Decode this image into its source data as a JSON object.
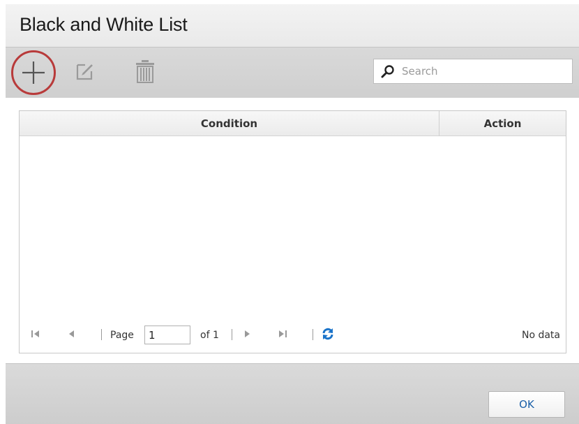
{
  "dialog": {
    "title": "Black and White List"
  },
  "toolbar": {
    "add_icon": "plus-icon",
    "edit_icon": "edit-icon",
    "delete_icon": "trash-icon",
    "search": {
      "placeholder": "Search",
      "value": "",
      "icon": "search-icon"
    },
    "highlight_color": "#b83a3a"
  },
  "grid": {
    "columns": [
      {
        "label": "Condition"
      },
      {
        "label": "Action"
      }
    ],
    "rows": []
  },
  "pager": {
    "page_label": "Page",
    "page_value": "1",
    "of_label": "of 1",
    "status": "No data",
    "refresh_color": "#1a73c9"
  },
  "footer": {
    "ok_label": "OK"
  }
}
